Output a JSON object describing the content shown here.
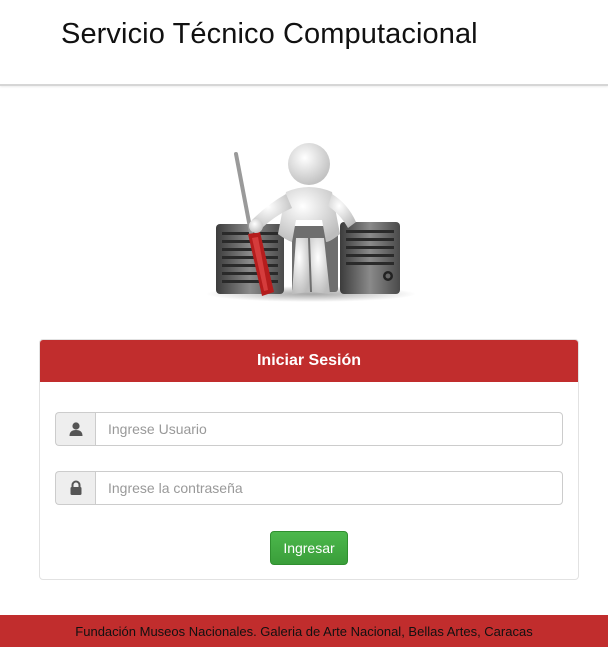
{
  "header": {
    "title": "Servicio Técnico Computacional"
  },
  "hero": {
    "image": "technician-figure-with-screwdriver-and-computers"
  },
  "login": {
    "title": "Iniciar Sesión",
    "username": {
      "placeholder": "Ingrese Usuario",
      "value": "",
      "icon": "user-icon"
    },
    "password": {
      "placeholder": "Ingrese la contraseña",
      "value": "",
      "icon": "lock-icon"
    },
    "submit_label": "Ingresar"
  },
  "footer": {
    "text": "Fundación Museos Nacionales. Galeria de Arte Nacional, Bellas Artes, Caracas"
  },
  "colors": {
    "brand_red": "#c12d2d",
    "button_green": "#3fa83f"
  }
}
